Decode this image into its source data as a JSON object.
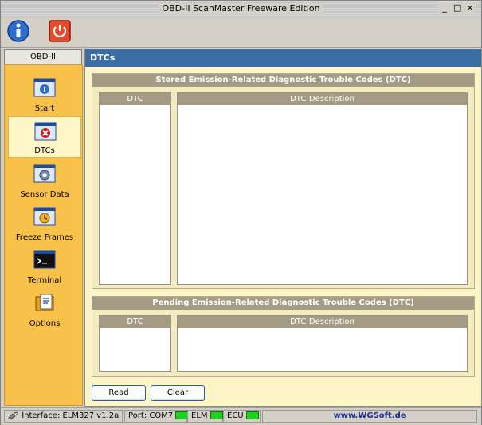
{
  "window": {
    "title": "OBD-II ScanMaster Freeware Edition",
    "min": "_",
    "max": "□",
    "close": "×"
  },
  "sidebar": {
    "header": "OBD-II",
    "items": [
      {
        "label": "Start"
      },
      {
        "label": "DTCs"
      },
      {
        "label": "Sensor Data"
      },
      {
        "label": "Freeze Frames"
      },
      {
        "label": "Terminal"
      },
      {
        "label": "Options"
      }
    ],
    "active": "DTCs"
  },
  "main": {
    "title": "DTCs",
    "stored": {
      "title": "Stored Emission-Related Diagnostic Trouble Codes (DTC)",
      "col_dtc": "DTC",
      "col_desc": "DTC-Description"
    },
    "pending": {
      "title": "Pending Emission-Related Diagnostic Trouble Codes (DTC)",
      "col_dtc": "DTC",
      "col_desc": "DTC-Description"
    },
    "read_label": "Read",
    "clear_label": "Clear"
  },
  "status": {
    "interface": "Interface: ELM327 v1.2a",
    "port": "Port: COM7",
    "elm": "ELM",
    "ecu": "ECU",
    "site": "www.WGSoft.de"
  },
  "colors": {
    "sidebar": "#f8c14a",
    "header": "#3a6ea5",
    "led": "#19d419",
    "panel": "#fdf5c6"
  }
}
